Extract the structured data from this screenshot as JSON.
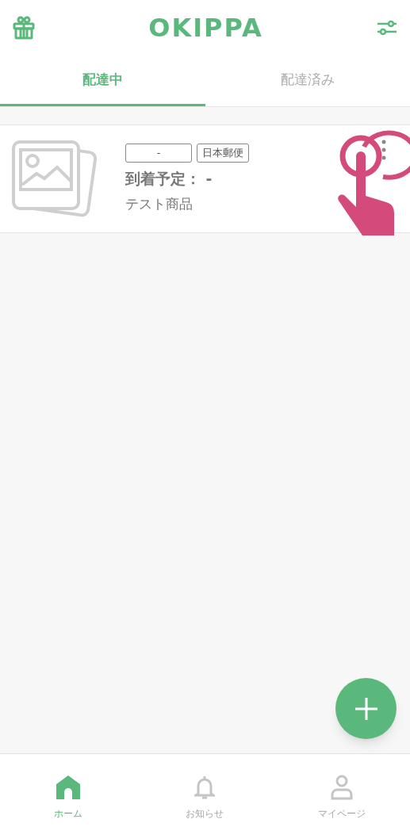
{
  "header": {
    "logo": "OKIPPA"
  },
  "tabs": [
    {
      "label": "配達中",
      "selected": true
    },
    {
      "label": "配達済み",
      "selected": false
    }
  ],
  "packages": [
    {
      "tracking_number": "-",
      "carrier": "日本郵便",
      "arrival": "到着予定： -",
      "name": "テスト商品"
    }
  ],
  "bottom_nav": [
    {
      "label": "ホーム",
      "selected": true
    },
    {
      "label": "お知らせ",
      "selected": false
    },
    {
      "label": "マイページ",
      "selected": false
    }
  ]
}
